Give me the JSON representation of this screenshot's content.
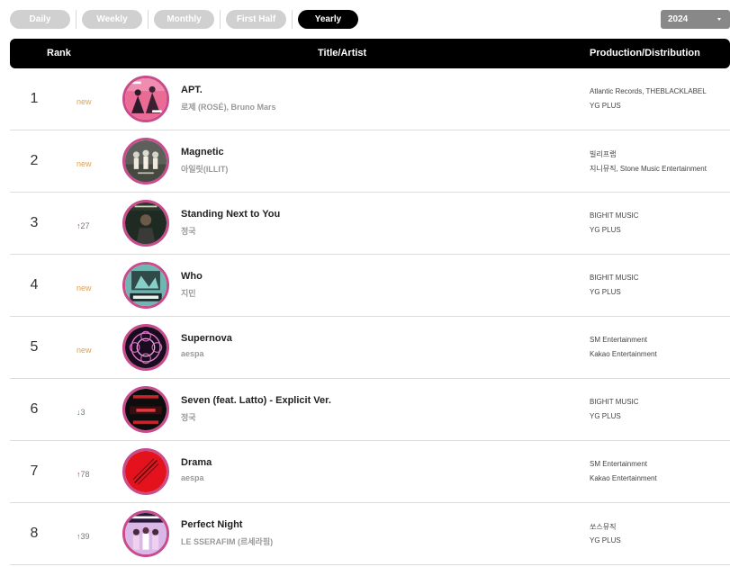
{
  "tabs": [
    {
      "label": "Daily",
      "active": false
    },
    {
      "label": "Weekly",
      "active": false
    },
    {
      "label": "Monthly",
      "active": false
    },
    {
      "label": "First Half",
      "active": false
    },
    {
      "label": "Yearly",
      "active": true
    }
  ],
  "year_select": {
    "value": "2024"
  },
  "table": {
    "headers": {
      "rank": "Rank",
      "title": "Title/Artist",
      "production": "Production/Distribution"
    },
    "rows": [
      {
        "rank": "1",
        "change_type": "new",
        "change_text": "new",
        "title": "APT.",
        "artist": "로제 (ROSÉ), Bruno Mars",
        "production": "Atlantic Records, THEBLACKLABEL",
        "distribution": "YG PLUS",
        "cover_icon": "apt-album-cover"
      },
      {
        "rank": "2",
        "change_type": "new",
        "change_text": "new",
        "title": "Magnetic",
        "artist": "아일릿(ILLIT)",
        "production": "빌리프랩",
        "distribution": "지니뮤직, Stone Music Entertainment",
        "cover_icon": "magnetic-album-cover"
      },
      {
        "rank": "3",
        "change_type": "up",
        "change_text": "27",
        "title": "Standing Next to You",
        "artist": "정국",
        "production": "BIGHIT MUSIC",
        "distribution": "YG PLUS",
        "cover_icon": "golden-album-cover"
      },
      {
        "rank": "4",
        "change_type": "new",
        "change_text": "new",
        "title": "Who",
        "artist": "지민",
        "production": "BIGHIT MUSIC",
        "distribution": "YG PLUS",
        "cover_icon": "muse-album-cover"
      },
      {
        "rank": "5",
        "change_type": "new",
        "change_text": "new",
        "title": "Supernova",
        "artist": "aespa",
        "production": "SM Entertainment",
        "distribution": "Kakao Entertainment",
        "cover_icon": "supernova-album-cover"
      },
      {
        "rank": "6",
        "change_type": "down",
        "change_text": "3",
        "title": "Seven (feat. Latto) - Explicit Ver.",
        "artist": "정국",
        "production": "BIGHIT MUSIC",
        "distribution": "YG PLUS",
        "cover_icon": "seven-album-cover"
      },
      {
        "rank": "7",
        "change_type": "up",
        "change_text": "78",
        "title": "Drama",
        "artist": "aespa",
        "production": "SM Entertainment",
        "distribution": "Kakao Entertainment",
        "cover_icon": "drama-album-cover"
      },
      {
        "rank": "8",
        "change_type": "up",
        "change_text": "39",
        "title": "Perfect Night",
        "artist": "LE SSERAFIM (르세라핌)",
        "production": "쏘스뮤직",
        "distribution": "YG PLUS",
        "cover_icon": "perfect-night-album-cover"
      }
    ]
  },
  "colors": {
    "cover_ring": "#c84b8c",
    "new": "#e0a050",
    "up": "#dd3333",
    "down": "#2a9a4a",
    "tab_inactive": "#d0d0d0",
    "tab_active": "#000000"
  }
}
